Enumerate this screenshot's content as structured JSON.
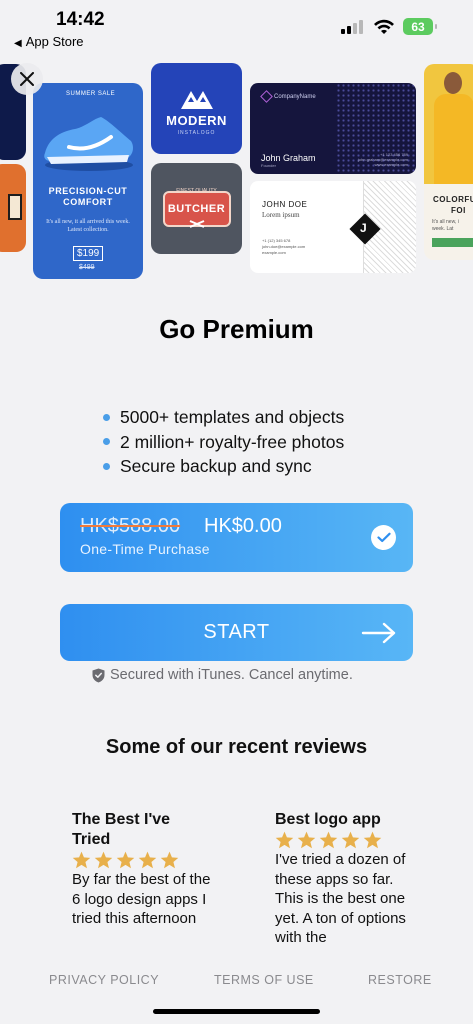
{
  "status_bar": {
    "time": "14:42",
    "back_label": "App Store",
    "battery": "63"
  },
  "banner": {
    "shoe_card": {
      "tag": "SUMMER SALE",
      "headline_1": "PRECISION-CUT",
      "headline_2": "COMFORT",
      "blurb": "It's all new, it all arrived this week. Latest collection.",
      "price": "$199",
      "old_price": "$499"
    },
    "modern_logo": {
      "word": "MODERN",
      "sub": "INSTALOGO"
    },
    "butcher_logo": {
      "word": "BUTCHER",
      "sub": "FINEST QUALITY"
    },
    "business_card": {
      "company": "CompanyName",
      "name": "John Graham",
      "role": "Founder",
      "contact_1": "+1 123 456 789",
      "contact_2": "john.graham@example.com",
      "contact_3": "www.example.com"
    },
    "john_doe_card": {
      "name": "JOHN DOE",
      "subtitle": "Lorem ipsum",
      "letter": "J",
      "line_1": "+1 (12) 345 678",
      "line_2": "john.doe@example.com",
      "line_3": "example.com"
    },
    "fashion_card": {
      "line_1": "COLORFU",
      "line_2": "FOI",
      "line_3": "It's all new, i",
      "line_4": "week. Lat"
    }
  },
  "title": "Go Premium",
  "features": [
    "5000+ templates and objects",
    "2 million+ royalty-free photos",
    "Secure backup and sync"
  ],
  "price_option": {
    "old_price": "HK$588.00",
    "new_price": "HK$0.00",
    "label": "One-Time Purchase",
    "selected": true
  },
  "start_button": {
    "label": "START"
  },
  "secured_text": "Secured with iTunes. Cancel anytime.",
  "reviews": {
    "heading": "Some of our recent reviews",
    "items": [
      {
        "title": "The Best I've Tried",
        "stars": 5,
        "text": "By far the best of the 6 logo design apps I tried this afternoon"
      },
      {
        "title": "Best logo app",
        "stars": 5,
        "text": "I've tried a dozen of these apps so far. This is the best one yet. A ton of options with the"
      }
    ],
    "star_color": "#e8b04b"
  },
  "footer": {
    "privacy": "PRIVACY POLICY",
    "terms": "TERMS OF USE",
    "restore": "RESTORE"
  },
  "colors": {
    "accent": "#2e8ff0",
    "bullet": "#4a9ee8",
    "battery": "#5ccb5f"
  }
}
